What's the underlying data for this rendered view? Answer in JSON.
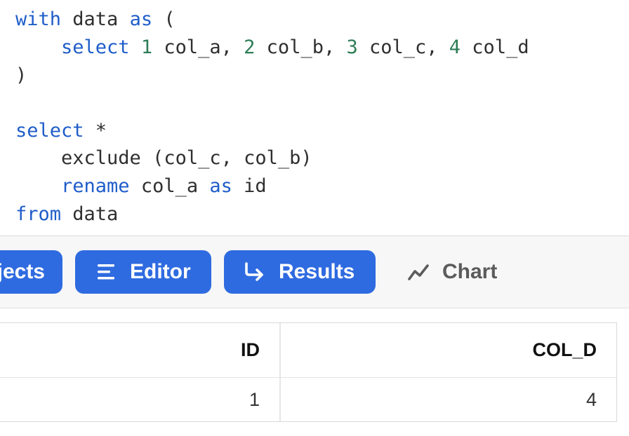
{
  "editor": {
    "line1": {
      "kw1": "with",
      "t1": " data ",
      "kw2": "as",
      "t2": " ("
    },
    "line2": {
      "indent": "    ",
      "kw1": "select",
      "sp": " ",
      "n1": "1",
      "t1": " col_a, ",
      "n2": "2",
      "t2": " col_b, ",
      "n3": "3",
      "t3": " col_c, ",
      "n4": "4",
      "t4": " col_d"
    },
    "line3": {
      "t1": ")"
    },
    "line5": {
      "kw1": "select",
      "t1": " *"
    },
    "line6": {
      "t1": "    exclude (col_c, col_b)"
    },
    "line7": {
      "indent": "    ",
      "kw1": "rename",
      "t1": " col_a ",
      "kw2": "as",
      "t2": " id"
    },
    "line8": {
      "kw1": "from",
      "t1": " data"
    }
  },
  "toolbar": {
    "objects_label": "Objects",
    "editor_label": "Editor",
    "results_label": "Results",
    "chart_label": "Chart"
  },
  "results": {
    "columns": [
      "ID",
      "COL_D"
    ],
    "rows": [
      [
        "1",
        "4"
      ]
    ]
  },
  "colors": {
    "keyword": "#1f5dc9",
    "number": "#2e7d57",
    "accent": "#2f6be0"
  },
  "icons": {
    "editor": "lines-icon",
    "results": "return-arrow-icon",
    "chart": "trend-line-icon"
  }
}
